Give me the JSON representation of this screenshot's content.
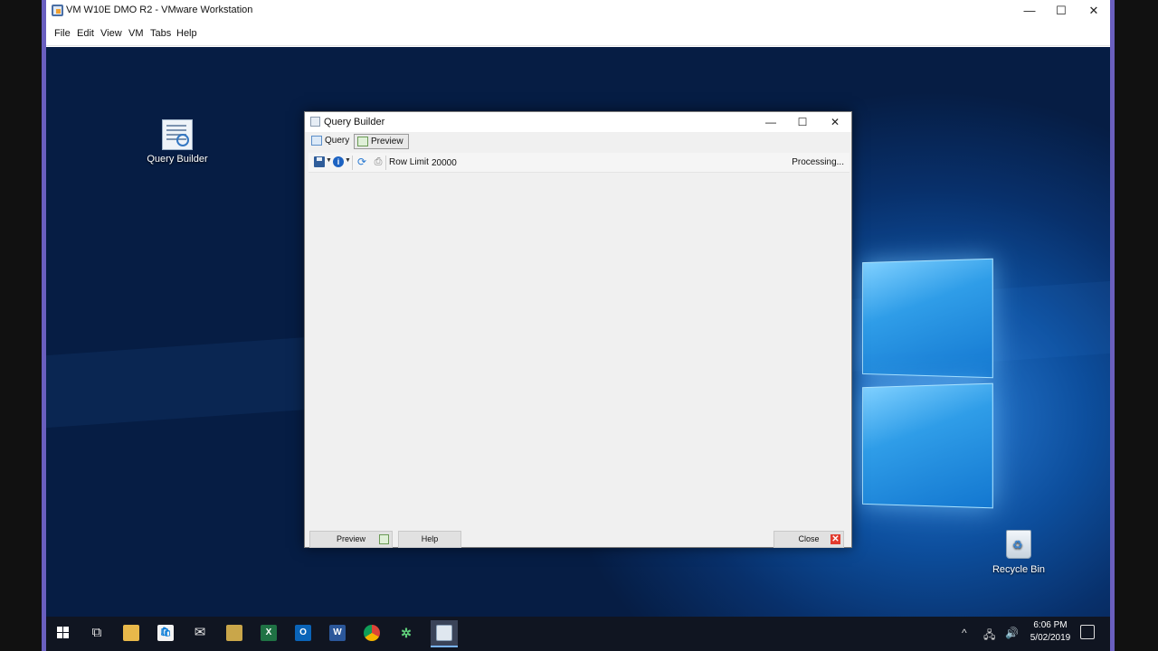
{
  "vmware": {
    "title": "VM W10E DMO R2 - VMware Workstation",
    "menu": [
      "File",
      "Edit",
      "View",
      "VM",
      "Tabs",
      "Help"
    ],
    "controls": {
      "minimize": "—",
      "maximize": "☐",
      "close": "✕"
    }
  },
  "desktop": {
    "icons": [
      {
        "label": "Query Builder",
        "icon": "query-builder-icon"
      },
      {
        "label": "Recycle Bin",
        "icon": "recycle-bin-icon"
      }
    ]
  },
  "dialog": {
    "title": "Query Builder",
    "controls": {
      "minimize": "—",
      "maximize": "☐",
      "close": "✕"
    },
    "tabs": [
      {
        "label": "Query",
        "active": false
      },
      {
        "label": "Preview",
        "active": true
      }
    ],
    "toolbar": {
      "row_limit_label": "Row Limit",
      "row_limit_value": "20000",
      "status": "Processing..."
    },
    "footer": {
      "preview_label": "Preview",
      "help_label": "Help",
      "close_label": "Close"
    }
  },
  "taskbar": {
    "apps": [
      "start",
      "task-view",
      "file-explorer",
      "store",
      "mail",
      "folder-app",
      "excel",
      "outlook",
      "word",
      "chrome",
      "tool-app",
      "query-builder"
    ],
    "tray": {
      "chevron": "^",
      "network": "🖧",
      "volume": "🔊"
    },
    "time": "6:06 PM",
    "date": "5/02/2019"
  },
  "colors": {
    "accent": "#0078d7",
    "taskbar": "#101521",
    "dialog_bg": "#f0f0f0"
  }
}
